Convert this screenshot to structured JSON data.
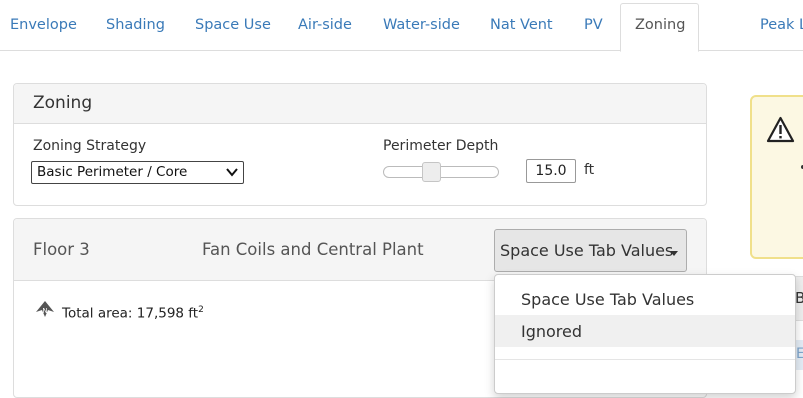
{
  "tabs": [
    {
      "label": "Envelope"
    },
    {
      "label": "Shading"
    },
    {
      "label": "Space Use"
    },
    {
      "label": "Air-side"
    },
    {
      "label": "Water-side"
    },
    {
      "label": "Nat Vent"
    },
    {
      "label": "PV"
    },
    {
      "label": "Zoning",
      "active": true
    },
    {
      "label": "Peak L"
    }
  ],
  "zoning_panel": {
    "title": "Zoning",
    "strategy_label": "Zoning Strategy",
    "strategy_value": "Basic Perimeter / Core",
    "perimeter_label": "Perimeter Depth",
    "perimeter_value": "15.0",
    "perimeter_unit": "ft",
    "slider_level_fraction": 0.4
  },
  "floor_panel": {
    "floor_name": "Floor 3",
    "system_name": "Fan Coils and Central Plant",
    "dropdown_value": "Space Use Tab Values",
    "total_area_label": "Total area: 17,598 ft",
    "total_area_sup": "2",
    "menu_options": [
      "Space Use Tab Values",
      "Ignored"
    ],
    "hovered_option": "Ignored"
  },
  "right_side": {
    "letter_1": "B",
    "letter_2": "E"
  },
  "colors": {
    "tab_link": "#3a7ab8",
    "panel_header_bg": "#f5f5f5",
    "warning_bg": "#fcf8e3",
    "warning_border": "#f0e08a"
  },
  "icons": [
    "chevron-down-icon",
    "north-arrow-icon",
    "warning-icon",
    "caret-down-icon"
  ]
}
